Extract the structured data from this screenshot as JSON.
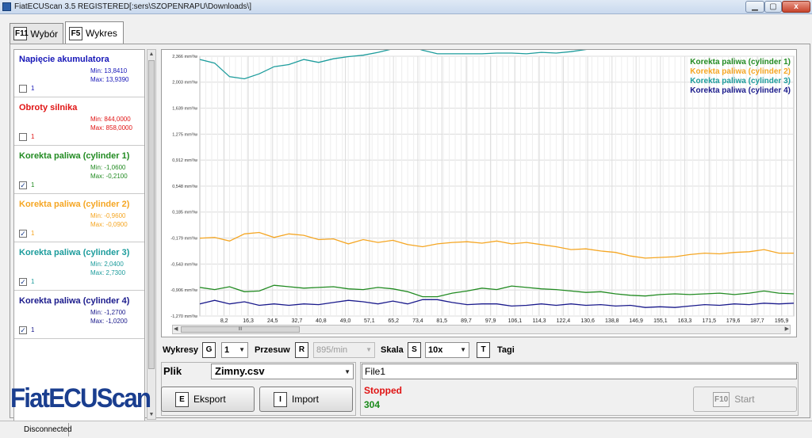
{
  "window": {
    "title": "FiatECUScan 3.5 REGISTERED[:sers\\SZOPENRAPU\\Downloads\\]",
    "min_glyph": "▁",
    "max_glyph": "▢",
    "close_glyph": "x"
  },
  "tabs": [
    {
      "key": "F11",
      "label": "Wybór",
      "active": false
    },
    {
      "key": "F5",
      "label": "Wykres",
      "active": true
    }
  ],
  "channels": [
    {
      "name": "Napięcie akumulatora",
      "min": "Min: 13,8410",
      "max": "Max: 13,9390",
      "checked": false,
      "index": "1",
      "color": "#1717b8"
    },
    {
      "name": "Obroty silnika",
      "min": "Min: 844,0000",
      "max": "Max: 858,0000",
      "checked": false,
      "index": "1",
      "color": "#e01414"
    },
    {
      "name": "Korekta paliwa (cylinder 1)",
      "min": "Min: -1,0600",
      "max": "Max: -0,2100",
      "checked": true,
      "index": "1",
      "color": "#228b22"
    },
    {
      "name": "Korekta paliwa (cylinder 2)",
      "min": "Min: -0,9600",
      "max": "Max: -0,0900",
      "checked": true,
      "index": "1",
      "color": "#f5a623"
    },
    {
      "name": "Korekta paliwa (cylinder 3)",
      "min": "Min: 2,0400",
      "max": "Max: 2,7300",
      "checked": true,
      "index": "1",
      "color": "#1c9c9c"
    },
    {
      "name": "Korekta paliwa (cylinder 4)",
      "min": "Min: -1,2700",
      "max": "Max: -1,0200",
      "checked": true,
      "index": "1",
      "color": "#1a1a8c"
    }
  ],
  "brand": {
    "logo_text": "FiatECUScan"
  },
  "chart_data": {
    "type": "line",
    "y_tick_labels": [
      "2,366 mm³/w",
      "2,003 mm³/w",
      "1,639 mm³/w",
      "1,275 mm³/w",
      "0,912 mm³/w",
      "0,548 mm³/w",
      "0,185 mm³/w",
      "-0,179 mm³/w",
      "-0,543 mm³/w",
      "-0,906 mm³/w",
      "-1,270 mm³/w"
    ],
    "y_ticks": [
      2.366,
      2.003,
      1.639,
      1.275,
      0.912,
      0.548,
      0.185,
      -0.179,
      -0.543,
      -0.906,
      -1.27
    ],
    "ylim": [
      -1.27,
      2.366
    ],
    "x_tick_labels": [
      "8,2",
      "16,3",
      "24,5",
      "32,7",
      "40,8",
      "49,0",
      "57,1",
      "65,2",
      "73,4",
      "81,5",
      "89,7",
      "97,9",
      "106,1",
      "114,3",
      "122,4",
      "130,6",
      "138,8",
      "146,9",
      "155,1",
      "163,3",
      "171,5",
      "179,6",
      "187,7",
      "195,9"
    ],
    "x_ticks": [
      8.2,
      16.3,
      24.5,
      32.7,
      40.8,
      49.0,
      57.1,
      65.2,
      73.4,
      81.5,
      89.7,
      97.9,
      106.1,
      114.3,
      122.4,
      130.6,
      138.8,
      146.9,
      155.1,
      163.3,
      171.5,
      179.6,
      187.7,
      195.9
    ],
    "xlim": [
      0,
      200
    ],
    "grid": true,
    "legend_position": "top-right",
    "series": [
      {
        "name": "Korekta paliwa (cylinder 1)",
        "color": "#228b22",
        "x": [
          0,
          5,
          10,
          15,
          20,
          25,
          30,
          35,
          40,
          45,
          50,
          55,
          60,
          65,
          70,
          75,
          80,
          85,
          90,
          95,
          100,
          105,
          110,
          115,
          120,
          125,
          130,
          135,
          140,
          145,
          150,
          155,
          160,
          165,
          170,
          175,
          180,
          185,
          190,
          195,
          200
        ],
        "values": [
          -0.87,
          -0.9,
          -0.86,
          -0.93,
          -0.92,
          -0.84,
          -0.86,
          -0.88,
          -0.87,
          -0.86,
          -0.89,
          -0.9,
          -0.87,
          -0.89,
          -0.93,
          -1.0,
          -1.0,
          -0.95,
          -0.92,
          -0.88,
          -0.9,
          -0.85,
          -0.87,
          -0.89,
          -0.9,
          -0.92,
          -0.94,
          -0.93,
          -0.96,
          -0.98,
          -0.99,
          -0.97,
          -0.96,
          -0.97,
          -0.96,
          -0.95,
          -0.97,
          -0.95,
          -0.92,
          -0.95,
          -0.96
        ]
      },
      {
        "name": "Korekta paliwa (cylinder 2)",
        "color": "#f5a623",
        "x": [
          0,
          5,
          10,
          15,
          20,
          25,
          30,
          35,
          40,
          45,
          50,
          55,
          60,
          65,
          70,
          75,
          80,
          85,
          90,
          95,
          100,
          105,
          110,
          115,
          120,
          125,
          130,
          135,
          140,
          145,
          150,
          155,
          160,
          165,
          170,
          175,
          180,
          185,
          190,
          195,
          200
        ],
        "values": [
          -0.18,
          -0.17,
          -0.22,
          -0.12,
          -0.1,
          -0.17,
          -0.12,
          -0.14,
          -0.2,
          -0.19,
          -0.26,
          -0.2,
          -0.24,
          -0.21,
          -0.27,
          -0.3,
          -0.26,
          -0.24,
          -0.23,
          -0.25,
          -0.22,
          -0.26,
          -0.24,
          -0.27,
          -0.3,
          -0.34,
          -0.33,
          -0.36,
          -0.38,
          -0.43,
          -0.46,
          -0.45,
          -0.44,
          -0.41,
          -0.39,
          -0.4,
          -0.38,
          -0.37,
          -0.34,
          -0.39,
          -0.39
        ]
      },
      {
        "name": "Korekta paliwa (cylinder 3)",
        "color": "#1c9c9c",
        "x": [
          0,
          5,
          10,
          15,
          20,
          25,
          30,
          35,
          40,
          45,
          50,
          55,
          60,
          65,
          70,
          75,
          80,
          85,
          90,
          95,
          100,
          105,
          110,
          115,
          120,
          125,
          130,
          135,
          140,
          145,
          150,
          155,
          160,
          165,
          170,
          175,
          180,
          185,
          190,
          195,
          200
        ],
        "values": [
          2.32,
          2.27,
          2.08,
          2.05,
          2.12,
          2.22,
          2.25,
          2.32,
          2.28,
          2.33,
          2.36,
          2.38,
          2.42,
          2.47,
          2.52,
          2.45,
          2.4,
          2.4,
          2.4,
          2.4,
          2.41,
          2.41,
          2.4,
          2.42,
          2.41,
          2.43,
          2.46,
          2.51,
          2.54,
          2.6,
          2.66,
          2.71,
          2.69,
          2.65,
          2.58,
          2.56,
          2.54,
          2.6,
          2.63,
          2.61,
          2.64
        ]
      },
      {
        "name": "Korekta paliwa (cylinder 4)",
        "color": "#1a1a8c",
        "x": [
          0,
          5,
          10,
          15,
          20,
          25,
          30,
          35,
          40,
          45,
          50,
          55,
          60,
          65,
          70,
          75,
          80,
          85,
          90,
          95,
          100,
          105,
          110,
          115,
          120,
          125,
          130,
          135,
          140,
          145,
          150,
          155,
          160,
          165,
          170,
          175,
          180,
          185,
          190,
          195,
          200
        ],
        "values": [
          -1.1,
          -1.05,
          -1.1,
          -1.07,
          -1.12,
          -1.1,
          -1.12,
          -1.1,
          -1.11,
          -1.08,
          -1.05,
          -1.07,
          -1.1,
          -1.06,
          -1.1,
          -1.04,
          -1.04,
          -1.08,
          -1.11,
          -1.1,
          -1.1,
          -1.13,
          -1.12,
          -1.1,
          -1.12,
          -1.1,
          -1.12,
          -1.11,
          -1.13,
          -1.12,
          -1.15,
          -1.14,
          -1.15,
          -1.13,
          -1.11,
          -1.12,
          -1.1,
          -1.11,
          -1.09,
          -1.1,
          -1.09
        ]
      }
    ]
  },
  "controls": {
    "wykresy_label": "Wykresy",
    "wykresy_key": "G",
    "wykresy_value": "1",
    "przesuw_label": "Przesuw",
    "przesuw_key": "R",
    "przesuw_value": "895/min",
    "skala_label": "Skala",
    "skala_key": "S",
    "skala_value": "10x",
    "tagi_key": "T",
    "tagi_label": "Tagi",
    "dropdown_glyph": "▼"
  },
  "file": {
    "plik_label": "Plik",
    "selected": "Zimny.csv",
    "export_key": "E",
    "export_label": "Eksport",
    "import_key": "I",
    "import_label": "Import"
  },
  "status": {
    "file_name": "File1",
    "state": "Stopped",
    "count": "304",
    "start_key": "F10",
    "start_label": "Start"
  },
  "statusbar": {
    "connection": "Disconnected"
  },
  "scroll": {
    "thumb_grip": "III",
    "up": "▲",
    "down": "▼",
    "left": "◀",
    "right": "▶"
  }
}
